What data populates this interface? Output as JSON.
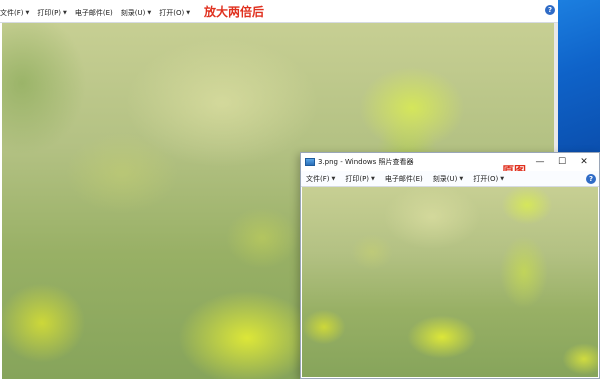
{
  "enlarged_window": {
    "annotation": "放大两倍后",
    "menu": [
      "文件(F)",
      "打印(P)",
      "电子邮件(E)",
      "刻录(U)",
      "打开(O)"
    ],
    "help": "?"
  },
  "original_window": {
    "title": "3.png - Windows 照片查看器",
    "annotation": "原图",
    "menu": [
      "文件(F)",
      "打印(P)",
      "电子邮件(E)",
      "刻录(U)",
      "打开(O)"
    ],
    "help": "?",
    "controls": {
      "minimize": "—",
      "maximize": "☐",
      "close": "✕"
    }
  },
  "icons": {
    "dropdown": "▼",
    "app_icon": "photo-viewer-icon"
  },
  "colors": {
    "annotation": "#e0301e",
    "help_icon": "#2f6bc6",
    "desktop": "#0f63c9"
  }
}
